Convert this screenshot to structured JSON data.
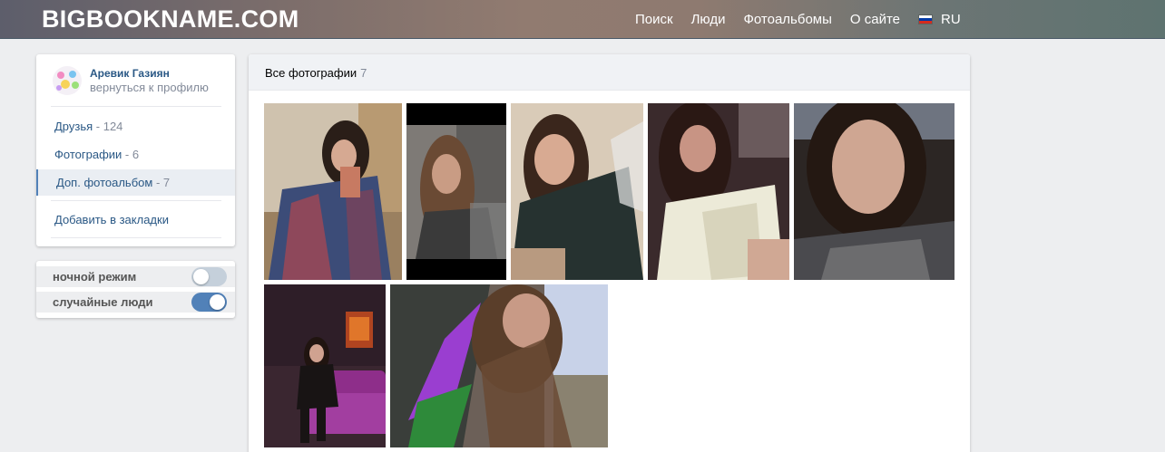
{
  "header": {
    "logo": "BIGBOOKNAME.COM",
    "nav": [
      "Поиск",
      "Люди",
      "Фотоальбомы",
      "О сайте"
    ],
    "language": "RU",
    "flag_colors": [
      "#ffffff",
      "#0039a6",
      "#d52b1e"
    ]
  },
  "profile": {
    "name": "Аревик Газиян",
    "back_link": "вернуться к профилю"
  },
  "menu": [
    {
      "label": "Друзья",
      "count": " - 124"
    },
    {
      "label": "Фотографии",
      "count": " - 6"
    },
    {
      "label": "Доп. фотоальбом",
      "count": " - 7",
      "active": true
    },
    {
      "label": "Добавить в закладки",
      "count": ""
    }
  ],
  "toggles": [
    {
      "label": "ночной режим",
      "state": "off"
    },
    {
      "label": "случайные люди",
      "state": "on"
    }
  ],
  "album": {
    "title": "Все фотографии",
    "count": "7"
  },
  "colors": {
    "link": "#2a5885",
    "muted": "#828a99",
    "accent": "#5181b8",
    "background": "#edeef0"
  }
}
